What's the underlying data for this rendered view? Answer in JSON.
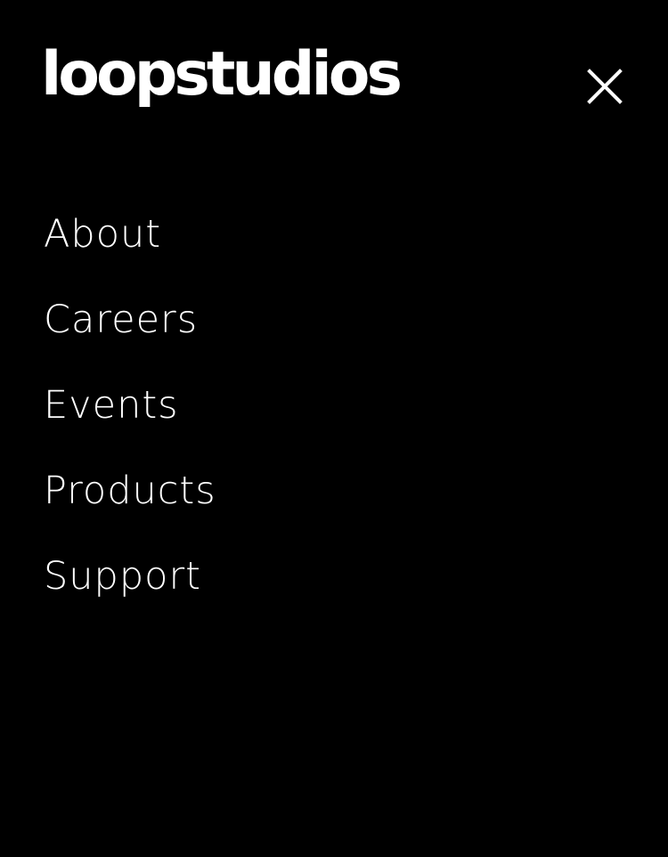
{
  "header": {
    "logo_text": "loopstudios",
    "close_icon": "close-icon"
  },
  "colors": {
    "background": "#000000",
    "text": "#ffffff"
  },
  "nav": {
    "items": [
      {
        "label": "About"
      },
      {
        "label": "Careers"
      },
      {
        "label": "Events"
      },
      {
        "label": "Products"
      },
      {
        "label": "Support"
      }
    ]
  }
}
